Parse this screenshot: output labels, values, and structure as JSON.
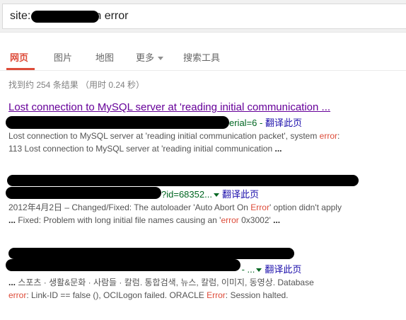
{
  "search": {
    "query_prefix": "site:",
    "query_suffix": "n error"
  },
  "tabs": [
    {
      "label": "网页"
    },
    {
      "label": "图片"
    },
    {
      "label": "地图"
    },
    {
      "label": "更多"
    },
    {
      "label": "搜索工具"
    }
  ],
  "stats": {
    "text": "找到约 254 条结果 （用时 0.24 秒）"
  },
  "results": [
    {
      "title": "Lost connection to MySQL server at 'reading initial communication ...",
      "url_suffix": "erial=6",
      "translate": "翻译此页",
      "line1_a": "Lost connection to MySQL server at 'reading initial communication packet', system ",
      "line1_kw": "error",
      "line1_b": ":",
      "line2_a": "113 Lost connection to MySQL server at 'reading initial communication ",
      "line2_b": "..."
    },
    {
      "url_suffix": "?id=68352...",
      "translate": "翻译此页",
      "line1_a": "2012年4月2日 – Changed/Fixed: The autoloader 'Auto Abort On ",
      "line1_kw": "Error",
      "line1_b": "' option didn't apply",
      "line2_dots": "...",
      "line2_a": " Fixed: Problem with long initial file names causing an '",
      "line2_kw": "error",
      "line2_b": " 0x3002'",
      "line2_c": "..."
    },
    {
      "url_suffix": " - ...",
      "translate": "翻译此页",
      "line1_dots": "...",
      "line1_a": " 스포츠 · 생활&문화 · 사람들 · 칼럼. 통합검색, 뉴스, 칼럼, 이미지, 동영상. Database",
      "line2_kw1": "error",
      "line2_a": ": Link-ID == false (), OCILogon failed. ORACLE ",
      "line2_kw2": "Error",
      "line2_b": ": Session halted."
    }
  ],
  "colors": {
    "accent": "#dd4b39",
    "link": "#1a0dab",
    "visited": "#660099",
    "url": "#006621",
    "snippet": "#545454"
  }
}
